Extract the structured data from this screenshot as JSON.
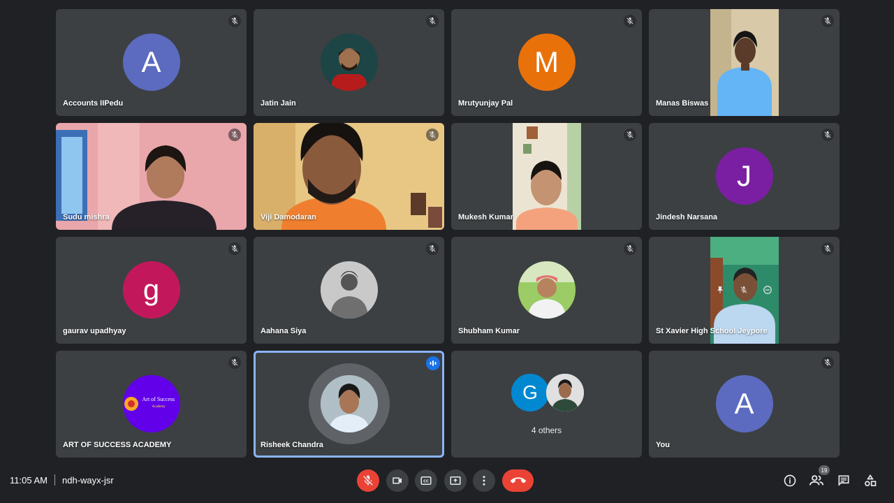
{
  "participants": [
    {
      "name": "Accounts IIPedu",
      "initial": "A",
      "color": "#5c6bc0"
    },
    {
      "name": "Jatin Jain"
    },
    {
      "name": "Mrutyunjay Pal",
      "initial": "M",
      "color": "#e8710a"
    },
    {
      "name": "Manas Biswas"
    },
    {
      "name": "Sudu mishra"
    },
    {
      "name": "Viji Damodaran"
    },
    {
      "name": "Mukesh Kumar"
    },
    {
      "name": "Jindesh Narsana",
      "initial": "J",
      "color": "#7b1fa2"
    },
    {
      "name": "gaurav upadhyay",
      "initial": "g",
      "color": "#c2185b"
    },
    {
      "name": "Aahana Siya"
    },
    {
      "name": "Shubham Kumar"
    },
    {
      "name": "St Xavier High School Jeypore"
    },
    {
      "name": "ART OF SUCCESS ACADEMY",
      "logo_text": "Art of Success",
      "logo_sub": "Academy",
      "color": "#6200ea"
    },
    {
      "name": "Risheek Chandra"
    },
    {
      "others_label": "4 others",
      "initial": "G",
      "color": "#0288d1"
    },
    {
      "name": "You",
      "initial": "A",
      "color": "#5c6bc0"
    }
  ],
  "meeting": {
    "time": "11:05 AM",
    "code": "ndh-wayx-jsr",
    "participant_count": "19"
  },
  "colors": {
    "background": "#202124",
    "tile": "#3c4043",
    "end_call": "#ea4335",
    "active_speaker": "#8ab4f8"
  },
  "icons": {
    "tile_mute": "mic-off-icon",
    "controls": [
      "mic-off-icon",
      "camera-icon",
      "captions-icon",
      "present-icon",
      "more-options-icon",
      "end-call-icon"
    ],
    "right": [
      "info-icon",
      "people-icon",
      "chat-icon",
      "activities-icon"
    ]
  }
}
